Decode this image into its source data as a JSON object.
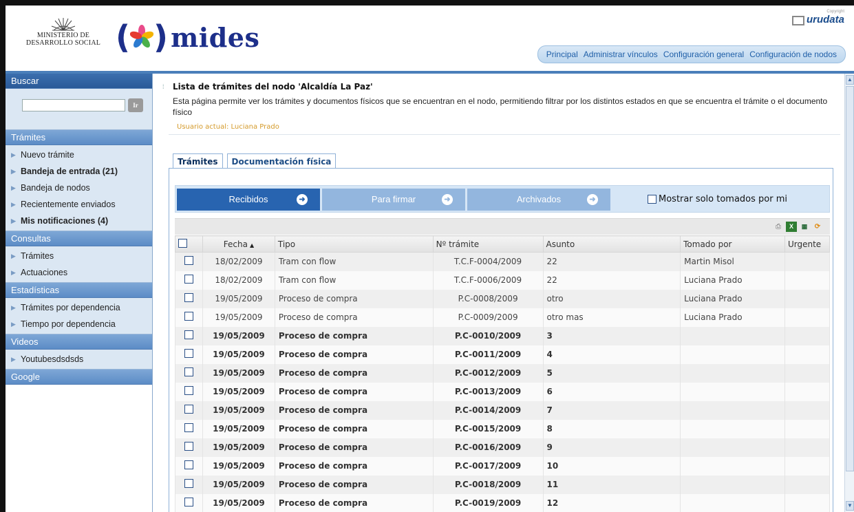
{
  "header": {
    "ministry": "MINISTERIO DE\nDESARROLLO SOCIAL",
    "ministry_line1": "MINISTERIO DE",
    "ministry_line2": "DESARROLLO SOCIAL",
    "brand": "mides",
    "copyright_small": "Copyright",
    "copyright_brand": "urudata",
    "nav": [
      "Principal",
      "Administrar vínculos",
      "Configuración general",
      "Configuración de nodos"
    ]
  },
  "sidebar": {
    "search_title": "Buscar",
    "search_value": "",
    "search_button": "Ir",
    "sections": [
      {
        "title": "Trámites",
        "items": [
          {
            "label": "Nuevo trámite",
            "bold": false
          },
          {
            "label": "Bandeja de entrada (21)",
            "bold": true
          },
          {
            "label": "Bandeja de nodos",
            "bold": false
          },
          {
            "label": "Recientemente enviados",
            "bold": false
          },
          {
            "label": "Mis notificaciones (4)",
            "bold": true
          }
        ]
      },
      {
        "title": "Consultas",
        "items": [
          {
            "label": "Trámites",
            "bold": false
          },
          {
            "label": "Actuaciones",
            "bold": false
          }
        ]
      },
      {
        "title": "Estadísticas",
        "items": [
          {
            "label": "Trámites por dependencia",
            "bold": false
          },
          {
            "label": "Tiempo por dependencia",
            "bold": false
          }
        ]
      },
      {
        "title": "Videos",
        "items": [
          {
            "label": "Youtubesdsdsds",
            "bold": false
          }
        ]
      }
    ],
    "last_section": "Google"
  },
  "main": {
    "title": "Lista de trámites del nodo 'Alcaldía La Paz'",
    "description": "Esta página permite ver los trámites y documentos físicos que se encuentran en el nodo, permitiendo filtrar por los distintos estados en que se encuentra el trámite o el documento físico",
    "current_user": "Usuario actual: Luciana Prado",
    "tabs": [
      "Trámites",
      "Documentación física"
    ],
    "filters": [
      "Recibidos",
      "Para firmar",
      "Archivados"
    ],
    "only_mine": "Mostrar solo tomados por mi",
    "columns": [
      "Fecha",
      "Tipo",
      "Nº trámite",
      "Asunto",
      "Tomado por",
      "Urgente"
    ],
    "rows": [
      {
        "fecha": "18/02/2009",
        "tipo": "Tram con flow",
        "numero": "T.C.F-0004/2009",
        "asunto": "22",
        "tomado": "Martin Misol",
        "bold": false
      },
      {
        "fecha": "18/02/2009",
        "tipo": "Tram con flow",
        "numero": "T.C.F-0006/2009",
        "asunto": "22",
        "tomado": "Luciana Prado",
        "bold": false
      },
      {
        "fecha": "19/05/2009",
        "tipo": "Proceso de compra",
        "numero": "P.C-0008/2009",
        "asunto": "otro",
        "tomado": "Luciana Prado",
        "bold": false
      },
      {
        "fecha": "19/05/2009",
        "tipo": "Proceso de compra",
        "numero": "P.C-0009/2009",
        "asunto": "otro mas",
        "tomado": "Luciana Prado",
        "bold": false
      },
      {
        "fecha": "19/05/2009",
        "tipo": "Proceso de compra",
        "numero": "P.C-0010/2009",
        "asunto": "3",
        "tomado": "",
        "bold": true
      },
      {
        "fecha": "19/05/2009",
        "tipo": "Proceso de compra",
        "numero": "P.C-0011/2009",
        "asunto": "4",
        "tomado": "",
        "bold": true
      },
      {
        "fecha": "19/05/2009",
        "tipo": "Proceso de compra",
        "numero": "P.C-0012/2009",
        "asunto": "5",
        "tomado": "",
        "bold": true
      },
      {
        "fecha": "19/05/2009",
        "tipo": "Proceso de compra",
        "numero": "P.C-0013/2009",
        "asunto": "6",
        "tomado": "",
        "bold": true
      },
      {
        "fecha": "19/05/2009",
        "tipo": "Proceso de compra",
        "numero": "P.C-0014/2009",
        "asunto": "7",
        "tomado": "",
        "bold": true
      },
      {
        "fecha": "19/05/2009",
        "tipo": "Proceso de compra",
        "numero": "P.C-0015/2009",
        "asunto": "8",
        "tomado": "",
        "bold": true
      },
      {
        "fecha": "19/05/2009",
        "tipo": "Proceso de compra",
        "numero": "P.C-0016/2009",
        "asunto": "9",
        "tomado": "",
        "bold": true
      },
      {
        "fecha": "19/05/2009",
        "tipo": "Proceso de compra",
        "numero": "P.C-0017/2009",
        "asunto": "10",
        "tomado": "",
        "bold": true
      },
      {
        "fecha": "19/05/2009",
        "tipo": "Proceso de compra",
        "numero": "P.C-0018/2009",
        "asunto": "11",
        "tomado": "",
        "bold": true
      },
      {
        "fecha": "19/05/2009",
        "tipo": "Proceso de compra",
        "numero": "P.C-0019/2009",
        "asunto": "12",
        "tomado": "",
        "bold": true
      }
    ]
  },
  "colors": {
    "brand_blue": "#1d2f8a",
    "active_filter": "#2864b0",
    "inactive_filter": "#93b6de",
    "sidebar_header": "#5c8cc6",
    "user_label": "#d49a2a"
  }
}
